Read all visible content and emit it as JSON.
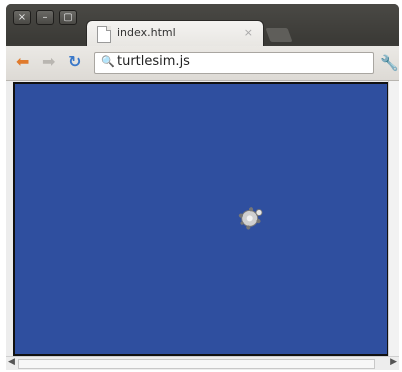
{
  "window": {
    "controls": [
      "close-icon",
      "minimize-icon",
      "maximize-icon"
    ]
  },
  "tab": {
    "title": "index.html",
    "close": "×"
  },
  "toolbar": {
    "back_icon": "back-arrow-icon",
    "forward_icon": "forward-arrow-icon",
    "reload_icon": "reload-icon",
    "url": "turtlesim.js",
    "wrench_icon": "wrench-icon"
  },
  "content": {
    "canvas_color": "#2f4f9f",
    "turtle_icon": "turtle-icon"
  },
  "colors": {
    "background": "#2f4f9f",
    "back_arrow": "#e07a2c",
    "reload": "#3a78c9"
  }
}
